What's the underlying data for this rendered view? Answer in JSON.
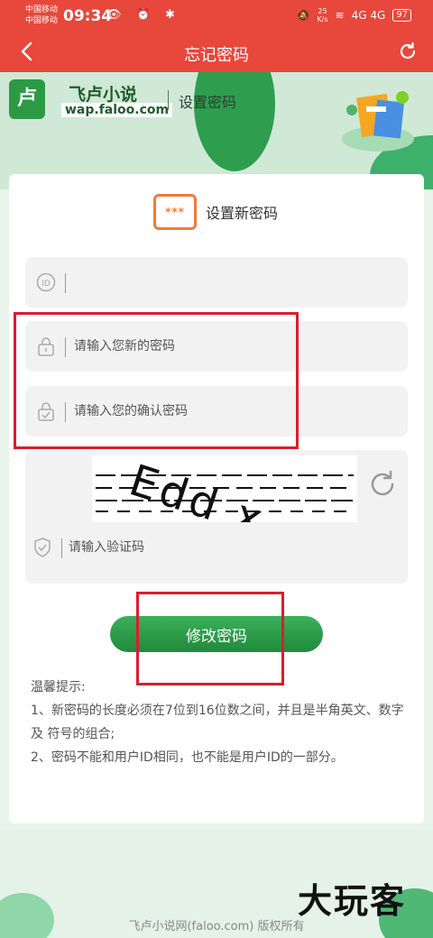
{
  "status_bar": {
    "carrier_1": "中国移动",
    "carrier_2": "中国移动",
    "time": "09:34",
    "icons_left": "👁 ⏰ ✱",
    "speed_value": "25",
    "speed_unit": "K/s",
    "signal": "4G 4G",
    "battery": "97"
  },
  "nav": {
    "title": "忘记密码"
  },
  "banner": {
    "logo_char": "卢",
    "brand_name": "飞卢小说",
    "brand_url": "wap.faloo.com",
    "subtitle": "设置密码"
  },
  "form": {
    "heading": "设置新密码",
    "heading_icon_text": "***",
    "user_id": {
      "value": "",
      "placeholder": ""
    },
    "new_password": {
      "value": "",
      "placeholder": "请输入您新的密码"
    },
    "confirm_password": {
      "value": "",
      "placeholder": "请输入您的确认密码"
    },
    "captcha_text": "Edd x",
    "captcha_input": {
      "value": "",
      "placeholder": "请输入验证码"
    },
    "submit_label": "修改密码"
  },
  "tips": {
    "title": "温馨提示:",
    "line_1": "1、新密码的长度必须在7位到16位数之间，并且是半角英文、数字及 符号的组合;",
    "line_2": "2、密码不能和用户ID相同，也不能是用户ID的一部分。"
  },
  "footer": {
    "copyright": "飞卢小说网(faloo.com) 版权所有",
    "watermark": "大玩客"
  },
  "colors": {
    "header_red": "#e8473b",
    "brand_green": "#2c9a45",
    "button_green": "#1f8a3c",
    "accent_orange": "#f07a3a",
    "highlight_red": "#d81e2c"
  }
}
